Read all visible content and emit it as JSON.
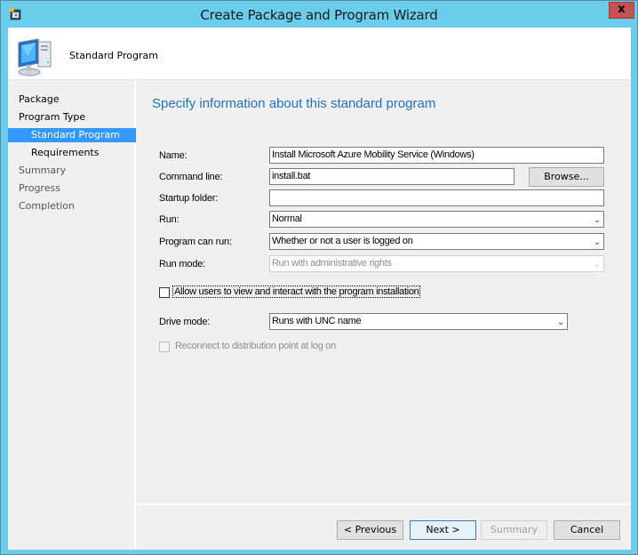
{
  "window": {
    "title": "Create Package and Program Wizard",
    "close_label": "x",
    "icons": {
      "app": "wizard-app-icon",
      "close": "close-icon"
    }
  },
  "header": {
    "title": "Standard Program",
    "icon": "computer-icon"
  },
  "sidebar": {
    "items": [
      {
        "label": "Package",
        "state": "done"
      },
      {
        "label": "Program Type",
        "state": "done"
      },
      {
        "label": "Standard Program",
        "state": "active"
      },
      {
        "label": "Requirements",
        "state": "done"
      },
      {
        "label": "Summary",
        "state": "pending"
      },
      {
        "label": "Progress",
        "state": "pending"
      },
      {
        "label": "Completion",
        "state": "pending"
      }
    ]
  },
  "main": {
    "heading": "Specify information about this standard program",
    "accent_color": "#1e73c4",
    "fields": {
      "name": {
        "label": "Name:",
        "value": "Install Microsoft Azure Mobility Service (Windows)"
      },
      "command_line": {
        "label": "Command line:",
        "value": "install.bat",
        "browse_label": "Browse..."
      },
      "startup_folder": {
        "label": "Startup folder:",
        "value": ""
      },
      "run": {
        "label": "Run:",
        "value": "Normal"
      },
      "program_can_run": {
        "label": "Program can run:",
        "value": "Whether or not a user is logged on"
      },
      "run_mode": {
        "label": "Run mode:",
        "value": "Run with administrative rights",
        "disabled": true
      },
      "allow_interact": {
        "label": "Allow users to view and interact with the program installation",
        "checked": false
      },
      "drive_mode": {
        "label": "Drive mode:",
        "value": "Runs with UNC name"
      },
      "reconnect": {
        "label": "Reconnect to distribution point at log on",
        "checked": false,
        "disabled": true
      }
    }
  },
  "footer": {
    "previous_label": "< Previous",
    "next_label": "Next >",
    "summary_label": "Summary",
    "cancel_label": "Cancel"
  }
}
